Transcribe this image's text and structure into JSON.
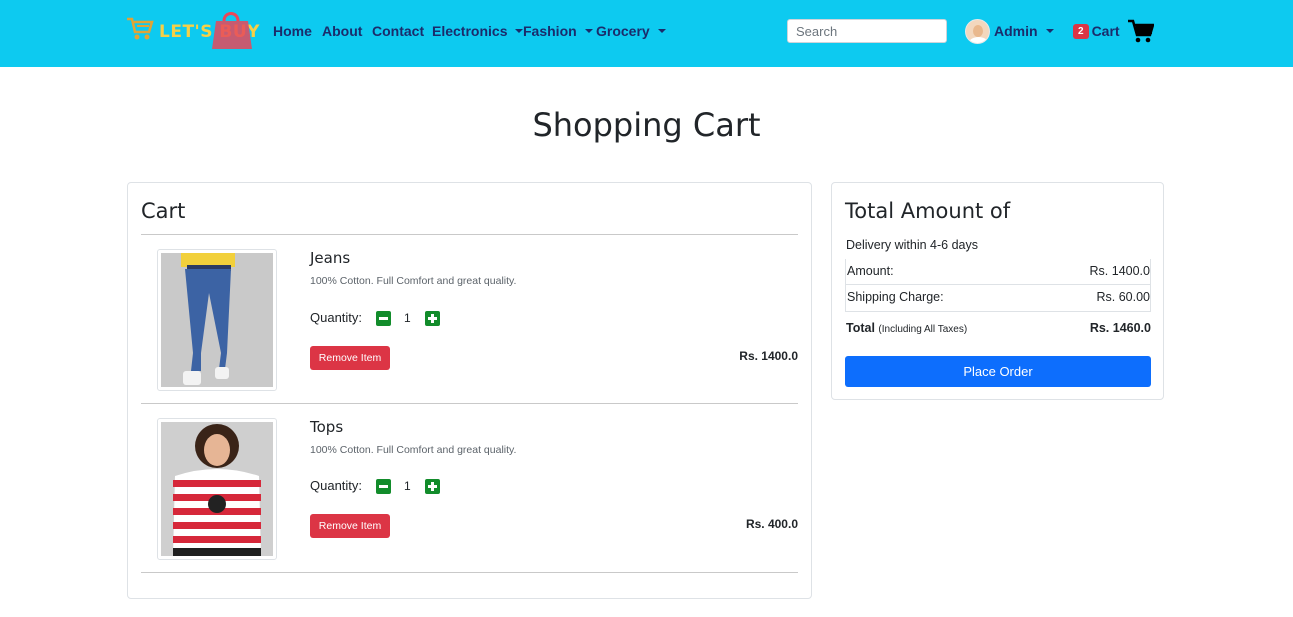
{
  "brand": {
    "logo_text": "LET'S BUY",
    "colors": {
      "navbar": "#0dcaf0",
      "logo_text": "#f7d046",
      "logo_bag": "#e8485a"
    }
  },
  "nav": {
    "links": [
      {
        "label": "Home",
        "dropdown": false
      },
      {
        "label": "About",
        "dropdown": false
      },
      {
        "label": "Contact",
        "dropdown": false
      },
      {
        "label": "Electronics",
        "dropdown": true
      },
      {
        "label": "Fashion",
        "dropdown": true
      },
      {
        "label": "Grocery",
        "dropdown": true
      }
    ],
    "search_placeholder": "Search",
    "user": {
      "name": "Admin",
      "icon": "avatar-icon"
    },
    "cart": {
      "count": "2",
      "label": "Cart",
      "icon": "shopping-cart-icon"
    }
  },
  "page": {
    "title": "Shopping Cart"
  },
  "cart": {
    "heading": "Cart",
    "items": [
      {
        "name": "Jeans",
        "description": "100% Cotton. Full Comfort and great quality.",
        "quantity_label": "Quantity:",
        "quantity": "1",
        "remove_label": "Remove Item",
        "price": "Rs. 1400.0",
        "image": "jeans-photo"
      },
      {
        "name": "Tops",
        "description": "100% Cotton. Full Comfort and great quality.",
        "quantity_label": "Quantity:",
        "quantity": "1",
        "remove_label": "Remove Item",
        "price": "Rs. 400.0",
        "image": "striped-top-photo"
      }
    ]
  },
  "summary": {
    "title": "Total Amount of",
    "delivery": "Delivery within 4-6 days",
    "rows": [
      {
        "label": "Amount:",
        "value": "Rs. 1400.0"
      },
      {
        "label": "Shipping Charge:",
        "value": "Rs. 60.00"
      }
    ],
    "total_label": "Total",
    "total_note": "(Including All Taxes)",
    "total_value": "Rs. 1460.0",
    "place_order_label": "Place Order",
    "colors": {
      "primary_button": "#0d6efd",
      "danger_button": "#dc3545",
      "quantity_button": "#128c2b"
    }
  }
}
